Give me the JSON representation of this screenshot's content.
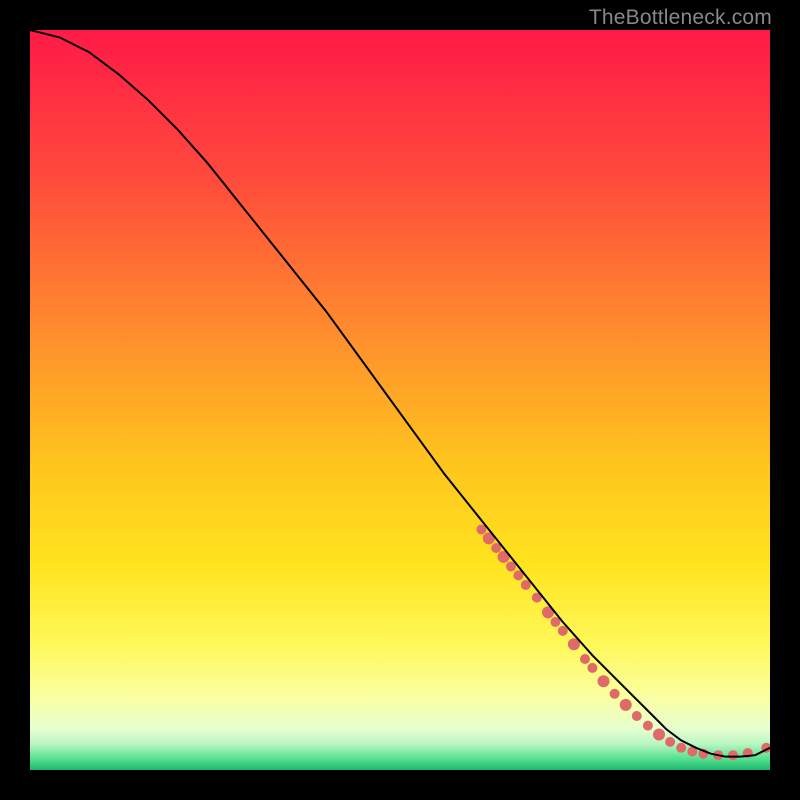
{
  "watermark": "TheBottleneck.com",
  "chart_data": {
    "type": "line",
    "title": "",
    "xlabel": "",
    "ylabel": "",
    "xlim": [
      0,
      100
    ],
    "ylim": [
      0,
      100
    ],
    "grid": false,
    "legend": false,
    "background_gradient_stops": [
      {
        "offset": 0.0,
        "color": "#ff1a47"
      },
      {
        "offset": 0.2,
        "color": "#ff4a3c"
      },
      {
        "offset": 0.4,
        "color": "#ff8a2e"
      },
      {
        "offset": 0.58,
        "color": "#ffc31e"
      },
      {
        "offset": 0.72,
        "color": "#ffe31e"
      },
      {
        "offset": 0.83,
        "color": "#fff85a"
      },
      {
        "offset": 0.9,
        "color": "#fbffa0"
      },
      {
        "offset": 0.945,
        "color": "#e6ffd0"
      },
      {
        "offset": 0.965,
        "color": "#b8f6c0"
      },
      {
        "offset": 0.985,
        "color": "#55e08f"
      },
      {
        "offset": 1.0,
        "color": "#1fb66d"
      }
    ],
    "series": [
      {
        "name": "bottleneck-curve",
        "x": [
          0,
          4,
          8,
          12,
          16,
          20,
          24,
          28,
          32,
          36,
          40,
          44,
          48,
          52,
          56,
          60,
          64,
          68,
          72,
          76,
          80,
          82,
          84,
          86,
          88,
          90,
          92,
          94,
          96,
          98,
          100
        ],
        "y": [
          100,
          99,
          97,
          94,
          90.5,
          86.5,
          82,
          77,
          72,
          67,
          62,
          56.5,
          51,
          45.5,
          40,
          35,
          30,
          25,
          20,
          15.5,
          11.5,
          9.5,
          7.5,
          5.5,
          4,
          3,
          2.2,
          1.8,
          1.8,
          2.0,
          3
        ],
        "color": "#000000"
      }
    ],
    "highlight_points": {
      "name": "highlighted-range",
      "color": "#e06a68",
      "points": [
        {
          "x": 61,
          "y": 32.5,
          "r": 5
        },
        {
          "x": 62,
          "y": 31.3,
          "r": 6
        },
        {
          "x": 63,
          "y": 30.0,
          "r": 5
        },
        {
          "x": 64,
          "y": 28.8,
          "r": 6
        },
        {
          "x": 65,
          "y": 27.5,
          "r": 5
        },
        {
          "x": 66,
          "y": 26.3,
          "r": 5
        },
        {
          "x": 67,
          "y": 25.0,
          "r": 5
        },
        {
          "x": 68.5,
          "y": 23.3,
          "r": 5
        },
        {
          "x": 70,
          "y": 21.3,
          "r": 6
        },
        {
          "x": 71,
          "y": 20.0,
          "r": 5
        },
        {
          "x": 72,
          "y": 18.8,
          "r": 5
        },
        {
          "x": 73.5,
          "y": 17.0,
          "r": 6
        },
        {
          "x": 75,
          "y": 15.0,
          "r": 5
        },
        {
          "x": 76,
          "y": 13.8,
          "r": 5
        },
        {
          "x": 77.5,
          "y": 12.0,
          "r": 6
        },
        {
          "x": 79,
          "y": 10.3,
          "r": 5
        },
        {
          "x": 80.5,
          "y": 8.8,
          "r": 6
        },
        {
          "x": 82,
          "y": 7.3,
          "r": 5
        },
        {
          "x": 83.5,
          "y": 6.0,
          "r": 5
        },
        {
          "x": 85,
          "y": 4.8,
          "r": 6
        },
        {
          "x": 86.5,
          "y": 3.8,
          "r": 5
        },
        {
          "x": 88,
          "y": 3.0,
          "r": 5
        },
        {
          "x": 89.5,
          "y": 2.5,
          "r": 5
        },
        {
          "x": 91,
          "y": 2.2,
          "r": 5
        },
        {
          "x": 93,
          "y": 2.0,
          "r": 5
        },
        {
          "x": 95,
          "y": 2.0,
          "r": 5
        },
        {
          "x": 97,
          "y": 2.3,
          "r": 5
        },
        {
          "x": 99.5,
          "y": 3.0,
          "r": 5
        }
      ]
    }
  }
}
